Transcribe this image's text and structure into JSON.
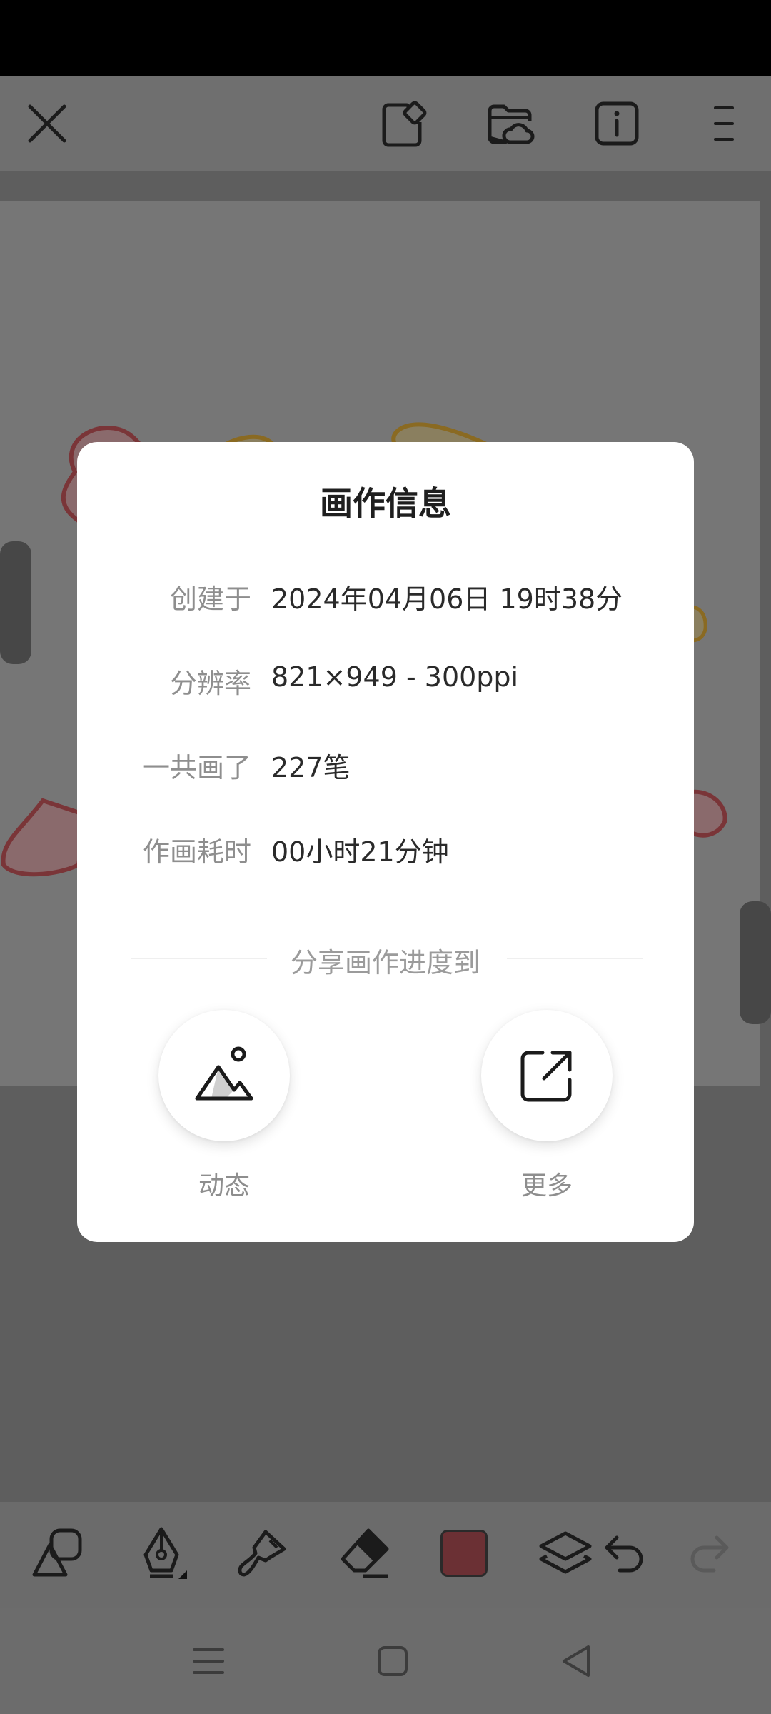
{
  "top_toolbar": {
    "icons": [
      "close-icon",
      "sticker-icon",
      "cloud-folder-icon",
      "info-icon",
      "menu-icon"
    ]
  },
  "dialog": {
    "title": "画作信息",
    "rows": [
      {
        "label": "创建于",
        "value": "2024年04月06日 19时38分"
      },
      {
        "label": "分辨率",
        "value": "821×949 - 300ppi"
      },
      {
        "label": "一共画了",
        "value": "227笔"
      },
      {
        "label": "作画耗时",
        "value": "00小时21分钟"
      }
    ],
    "share_title": "分享画作进度到",
    "share_options": [
      {
        "label": "动态",
        "icon": "mountain-image-icon"
      },
      {
        "label": "更多",
        "icon": "external-share-icon"
      }
    ]
  },
  "bottom_toolbar": {
    "icons": [
      "shapes-icon",
      "pen-icon",
      "smudge-icon",
      "eraser-icon",
      "color-swatch",
      "layers-icon",
      "undo-icon",
      "redo-icon"
    ],
    "current_color": "#6b3034"
  },
  "nav_bar": {
    "icons": [
      "recents-icon",
      "home-icon",
      "back-icon"
    ]
  },
  "colors": {
    "overlay_dialog": "#ffffff",
    "title_text": "#1f1f1f",
    "label_text": "#8e8e8e"
  }
}
